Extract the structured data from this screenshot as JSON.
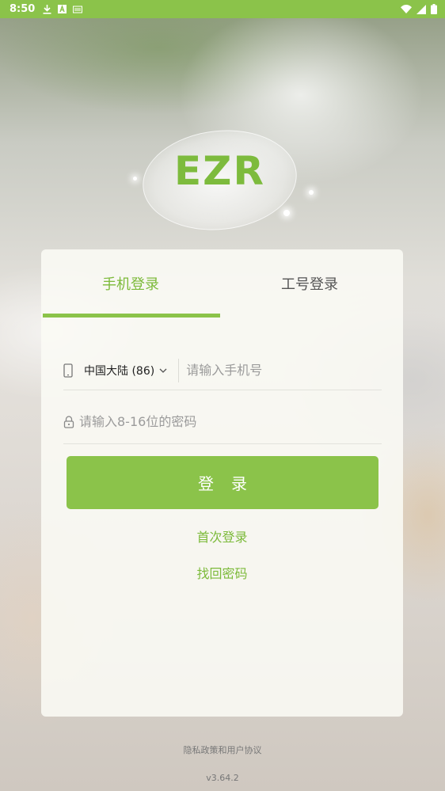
{
  "status_bar": {
    "time": "8:50",
    "icons_left": [
      "download-icon",
      "a-icon",
      "storage-icon"
    ],
    "icons_right": [
      "wifi-icon",
      "signal-icon",
      "battery-icon"
    ]
  },
  "logo": {
    "text": "EZR"
  },
  "tabs": [
    {
      "label": "手机登录",
      "active": true
    },
    {
      "label": "工号登录",
      "active": false
    }
  ],
  "phone": {
    "country": "中国大陆 (86)",
    "placeholder": "请输入手机号"
  },
  "password": {
    "placeholder": "请输入8-16位的密码"
  },
  "login_button": "登录",
  "links": {
    "first_login": "首次登录",
    "recover_password": "找回密码"
  },
  "footer": {
    "privacy": "隐私政策和用户协议",
    "version": "v3.64.2"
  },
  "colors": {
    "accent": "#8bc34a",
    "accent_text": "#7cba3a"
  }
}
